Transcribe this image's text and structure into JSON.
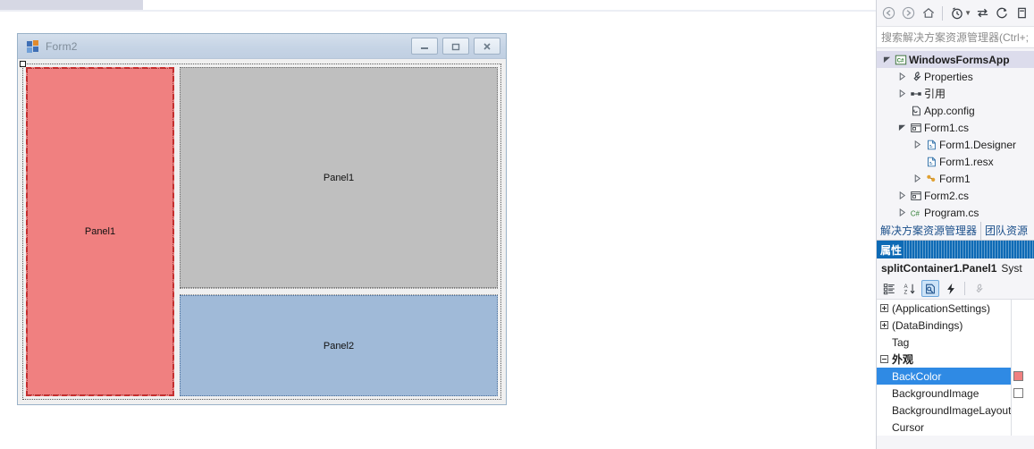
{
  "designer": {
    "form": {
      "title": "Form2",
      "icon": "form-icon",
      "caption_buttons": [
        {
          "name": "minimize-button",
          "glyph": "minimize"
        },
        {
          "name": "maximize-button",
          "glyph": "maximize"
        },
        {
          "name": "close-button",
          "glyph": "close"
        }
      ]
    },
    "panels": [
      {
        "name": "left-panel",
        "label": "Panel1",
        "color": "#F08080",
        "selected": true
      },
      {
        "name": "top-panel",
        "label": "Panel1",
        "color": "#BFBFBF",
        "selected": false
      },
      {
        "name": "bottom-panel",
        "label": "Panel2",
        "color": "#A0BAD8",
        "selected": false
      }
    ]
  },
  "solution_explorer": {
    "toolbar": [
      {
        "name": "back-icon",
        "title": "back"
      },
      {
        "name": "forward-icon",
        "title": "forward"
      },
      {
        "name": "home-icon",
        "title": "home"
      },
      {
        "name": "pending-changes-icon",
        "title": "pending changes"
      },
      {
        "name": "sync-with-active-document-icon",
        "title": "sync"
      },
      {
        "name": "refresh-icon",
        "title": "refresh"
      },
      {
        "name": "collapse-all-icon",
        "title": "collapse all"
      }
    ],
    "search": {
      "placeholder": "搜索解决方案资源管理器(Ctrl+;",
      "value": "搜索解决方案资源管理器(Ctrl+;"
    },
    "tree": [
      {
        "label": "WindowsFormsApp",
        "icon": "csharp-project-icon",
        "indent": 0,
        "twisty": "expanded",
        "root": true
      },
      {
        "label": "Properties",
        "icon": "properties-wrench-icon",
        "indent": 1,
        "twisty": "collapsed",
        "root": false
      },
      {
        "label": "引用",
        "icon": "references-icon",
        "indent": 1,
        "twisty": "collapsed",
        "root": false
      },
      {
        "label": "App.config",
        "icon": "config-file-icon",
        "indent": 1,
        "twisty": "none",
        "root": false
      },
      {
        "label": "Form1.cs",
        "icon": "form-file-icon",
        "indent": 1,
        "twisty": "expanded",
        "root": false
      },
      {
        "label": "Form1.Designer",
        "icon": "code-file-icon",
        "indent": 2,
        "twisty": "collapsed",
        "root": false
      },
      {
        "label": "Form1.resx",
        "icon": "code-file-icon",
        "indent": 2,
        "twisty": "none",
        "root": false
      },
      {
        "label": "Form1",
        "icon": "class-icon",
        "indent": 2,
        "twisty": "collapsed",
        "root": false
      },
      {
        "label": "Form2.cs",
        "icon": "form-file-icon",
        "indent": 1,
        "twisty": "collapsed",
        "root": false
      },
      {
        "label": "Program.cs",
        "icon": "csharp-file-icon",
        "indent": 1,
        "twisty": "collapsed",
        "root": false
      }
    ],
    "tabs": [
      {
        "label": "解决方案资源管理器",
        "active": true
      },
      {
        "label": "团队资源",
        "active": false
      }
    ]
  },
  "properties": {
    "header": "属性",
    "object_name": "splitContainer1.Panel1",
    "object_type": "Syst",
    "toolbar": [
      {
        "name": "categorized-button",
        "active": false,
        "disabled": false
      },
      {
        "name": "alphabetical-button",
        "active": false,
        "disabled": false
      },
      {
        "name": "properties-button",
        "active": true,
        "disabled": false
      },
      {
        "name": "events-button",
        "active": false,
        "disabled": false
      },
      {
        "name": "property-pages-button",
        "active": false,
        "disabled": true
      }
    ],
    "rows": [
      {
        "name": "(ApplicationSettings)",
        "expander": "plus",
        "category": false,
        "selected": false,
        "value_swatch": null
      },
      {
        "name": "(DataBindings)",
        "expander": "plus",
        "category": false,
        "selected": false,
        "value_swatch": null
      },
      {
        "name": "Tag",
        "expander": "none",
        "category": false,
        "selected": false,
        "value_swatch": null
      },
      {
        "name": "外观",
        "expander": "minus",
        "category": true,
        "selected": false,
        "value_swatch": null
      },
      {
        "name": "BackColor",
        "expander": "none",
        "category": false,
        "selected": true,
        "value_swatch": "#F08080"
      },
      {
        "name": "BackgroundImage",
        "expander": "none",
        "category": false,
        "selected": false,
        "value_swatch": "#FFFFFF"
      },
      {
        "name": "BackgroundImageLayout",
        "expander": "none",
        "category": false,
        "selected": false,
        "value_swatch": null
      },
      {
        "name": "Cursor",
        "expander": "none",
        "category": false,
        "selected": false,
        "value_swatch": null
      }
    ]
  }
}
